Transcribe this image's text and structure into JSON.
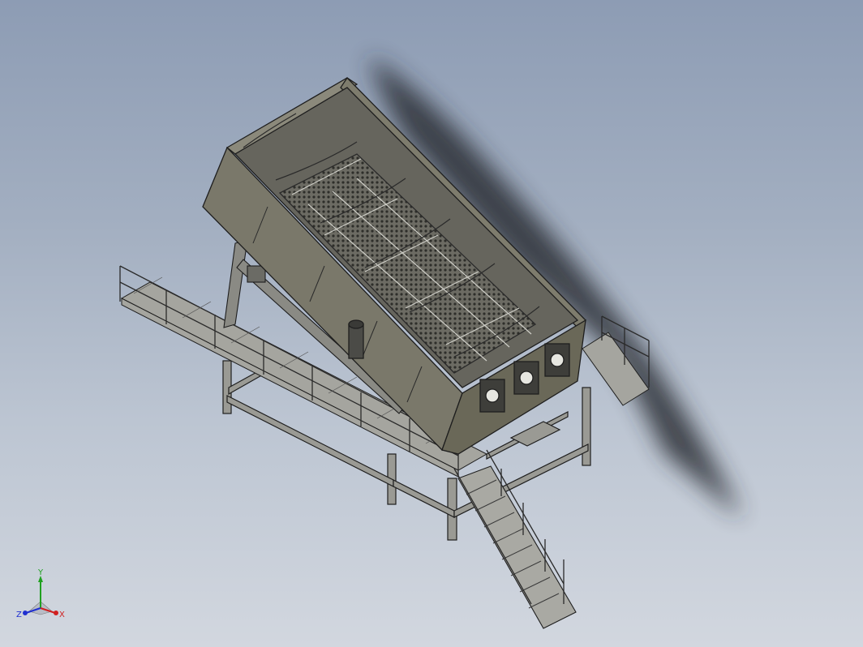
{
  "viewport": {
    "background_top": "#8d9cb4",
    "background_bottom": "#d2d7df"
  },
  "model": {
    "body_color": "#7e7c6d",
    "screen_deck_color": "#5a5a54",
    "frame_color": "#9a9a94",
    "edge_color": "#1e1e1e",
    "shadow_color": "#2a2d35"
  },
  "triad": {
    "x_label": "X",
    "y_label": "Y",
    "z_label": "Z",
    "x_color": "#d02020",
    "y_color": "#20a020",
    "z_color": "#2030d0"
  }
}
